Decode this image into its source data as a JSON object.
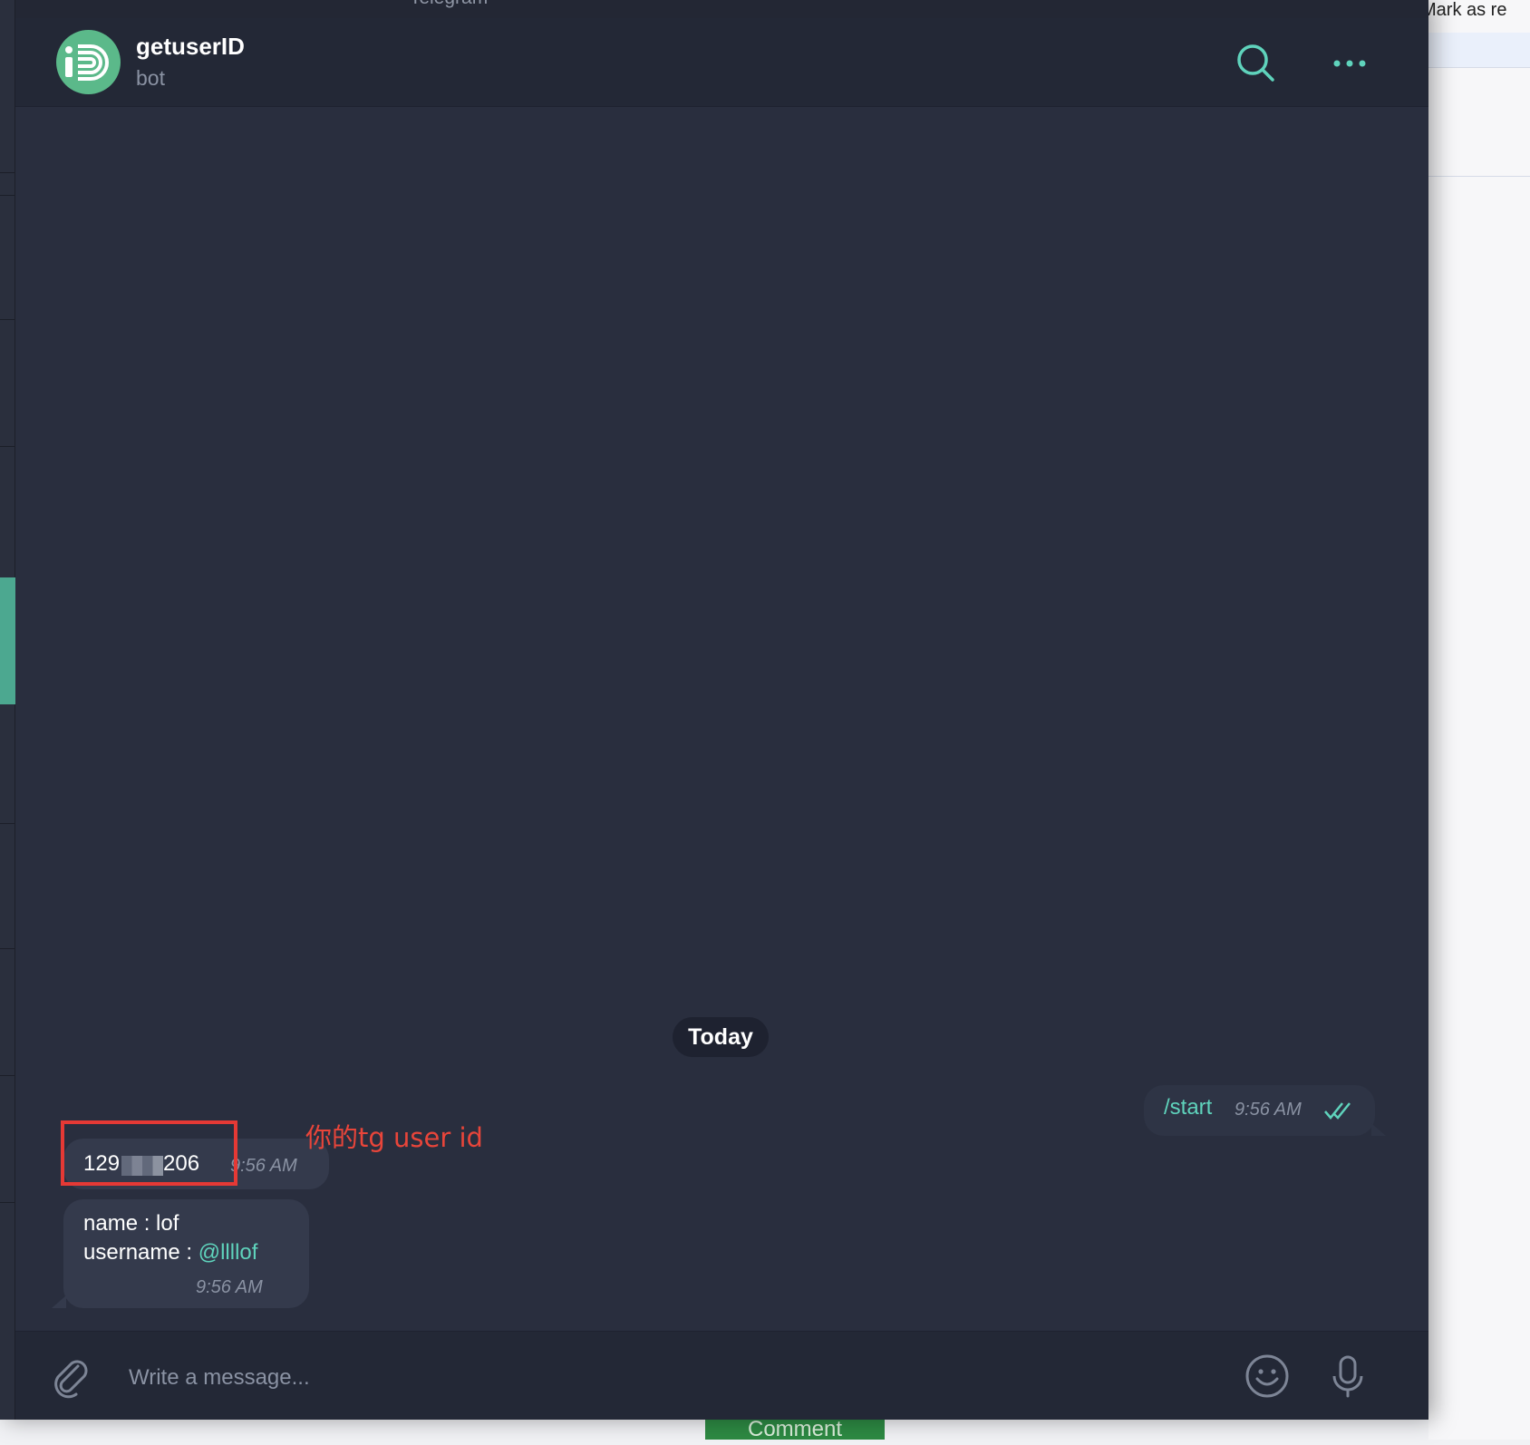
{
  "window": {
    "title": "Telegram"
  },
  "backdrop": {
    "right_text": "Mark as re",
    "bottom_button": "Comment"
  },
  "chat": {
    "name": "getuserID",
    "status": "bot",
    "header_icons": [
      "search-icon",
      "more-icon"
    ]
  },
  "messages": {
    "date_separator": "Today",
    "outgoing": {
      "text": "/start",
      "time": "9:56 AM",
      "status_icon": "double-check-icon"
    },
    "id_message": {
      "prefix": "129",
      "suffix": "206",
      "time": "9:56 AM"
    },
    "info_message": {
      "name_line": "name : lof",
      "username_label": "username : ",
      "username_link": "@llllof",
      "time": "9:56 AM"
    }
  },
  "annotation": {
    "text": "你的tg user id",
    "color": "#e53935"
  },
  "composer": {
    "placeholder": "Write a message...",
    "value": "",
    "icons": [
      "attach-icon",
      "emoji-icon",
      "microphone-icon"
    ]
  },
  "colors": {
    "accent": "#5fd3bc",
    "background": "#292e3e",
    "header": "#232836",
    "bubble_in": "#343a4c",
    "bubble_out": "#2e3445"
  }
}
